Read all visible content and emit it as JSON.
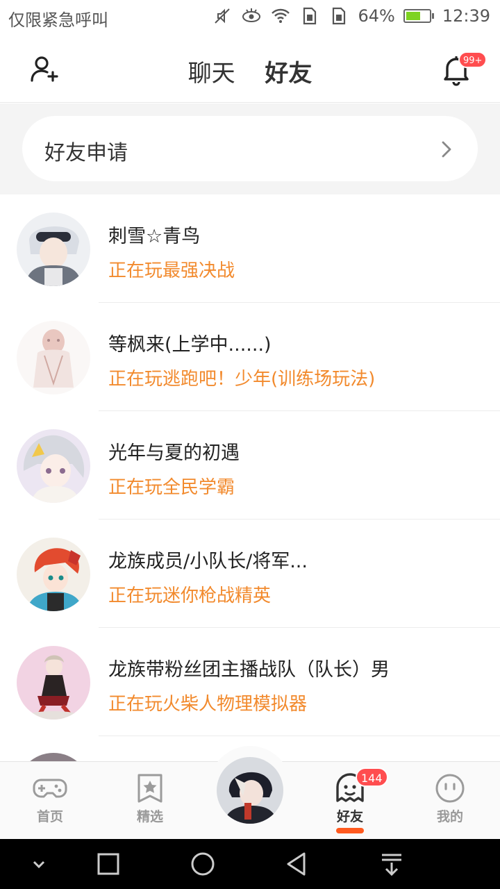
{
  "status_bar": {
    "carrier": "仅限紧急呼叫",
    "battery": "64%",
    "time": "12:39",
    "icons": [
      "mute-icon",
      "eye-icon",
      "wifi-icon",
      "sim-icon",
      "sim-icon",
      "battery-icon"
    ]
  },
  "header": {
    "tabs": [
      {
        "label": "聊天",
        "active": false
      },
      {
        "label": "好友",
        "active": true
      }
    ],
    "notification_badge": "99+"
  },
  "friend_request": {
    "label": "好友申请"
  },
  "friends": [
    {
      "name": "刺雪☆青鸟",
      "status": "正在玩最强决战",
      "avatar": "avatar-anime-boy-white-hair"
    },
    {
      "name": "等枫来(上学中......)",
      "status": "正在玩逃跑吧！少年(训练场玩法)",
      "avatar": "avatar-pale-figure"
    },
    {
      "name": "光年与夏的初遇",
      "status": "正在玩全民学霸",
      "avatar": "avatar-anime-silver-hair"
    },
    {
      "name": "龙族成员/小队长/将军...",
      "status": "正在玩迷你枪战精英",
      "avatar": "avatar-anime-red-hair"
    },
    {
      "name": "龙族带粉丝团主播战队（队长）男",
      "status": "正在玩火柴人物理模拟器",
      "avatar": "avatar-anime-pink-bg"
    }
  ],
  "bottom_nav": {
    "items": [
      {
        "label": "首页",
        "icon": "gamepad-icon",
        "active": false
      },
      {
        "label": "精选",
        "icon": "star-bookmark-icon",
        "active": false
      },
      {
        "label": "好友",
        "icon": "ghost-icon",
        "active": true,
        "badge": "144"
      },
      {
        "label": "我的",
        "icon": "face-icon",
        "active": false
      }
    ],
    "center_icon": "profile-avatar"
  },
  "colors": {
    "accent": "#ff5a1f",
    "status_text": "#f28a2d",
    "badge": "#ff4d4f"
  }
}
